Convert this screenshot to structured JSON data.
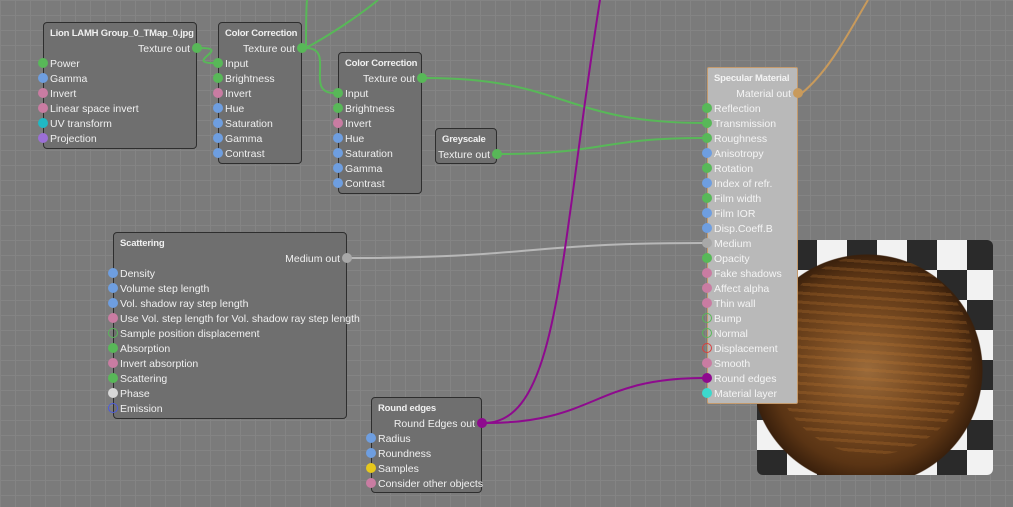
{
  "colors": {
    "green": "#58b858",
    "blue": "#6e9ee0",
    "pink": "#c97ca2",
    "teal": "#1fb9c4",
    "violet": "#9b6fd6",
    "yellow": "#e6c81c",
    "white": "#d8d8d8",
    "grey": "#a8a8a8",
    "red": "#d84040",
    "indigo": "#4a5ae0",
    "purple": "#8e0a8e",
    "cyan": "#3cd8cc",
    "orange": "#c89a5c"
  },
  "nodes": [
    {
      "id": "image",
      "title": "Lion LAMH Group_0_TMap_0.jpg",
      "output": "Texture out",
      "out_color": "green",
      "inputs": [
        {
          "label": "Power",
          "color": "green"
        },
        {
          "label": "Gamma",
          "color": "blue"
        },
        {
          "label": "Invert",
          "color": "pink"
        },
        {
          "label": "Linear space invert",
          "color": "pink"
        },
        {
          "label": "UV transform",
          "color": "teal"
        },
        {
          "label": "Projection",
          "color": "violet"
        }
      ]
    },
    {
      "id": "cc1",
      "title": "Color Correction",
      "output": "Texture out",
      "out_color": "green",
      "inputs": [
        {
          "label": "Input",
          "color": "green"
        },
        {
          "label": "Brightness",
          "color": "green"
        },
        {
          "label": "Invert",
          "color": "pink"
        },
        {
          "label": "Hue",
          "color": "blue"
        },
        {
          "label": "Saturation",
          "color": "blue"
        },
        {
          "label": "Gamma",
          "color": "blue"
        },
        {
          "label": "Contrast",
          "color": "blue"
        }
      ]
    },
    {
      "id": "cc2",
      "title": "Color Correction",
      "output": "Texture out",
      "out_color": "green",
      "inputs": [
        {
          "label": "Input",
          "color": "green"
        },
        {
          "label": "Brightness",
          "color": "green"
        },
        {
          "label": "Invert",
          "color": "pink"
        },
        {
          "label": "Hue",
          "color": "blue"
        },
        {
          "label": "Saturation",
          "color": "blue"
        },
        {
          "label": "Gamma",
          "color": "blue"
        },
        {
          "label": "Contrast",
          "color": "blue"
        }
      ]
    },
    {
      "id": "grey",
      "title": "Greyscale",
      "output": "Texture out",
      "out_color": "green",
      "inputs": []
    },
    {
      "id": "scatter",
      "title": "Scattering",
      "output": "Medium out",
      "out_color": "grey",
      "inputs": [
        {
          "label": "Density",
          "color": "blue"
        },
        {
          "label": "Volume step length",
          "color": "blue"
        },
        {
          "label": "Vol. shadow ray step length",
          "color": "blue"
        },
        {
          "label": "Use Vol. step length for Vol. shadow ray step length",
          "color": "pink"
        },
        {
          "label": "Sample position displacement",
          "color": "green",
          "hollow": true
        },
        {
          "label": "Absorption",
          "color": "green"
        },
        {
          "label": "Invert absorption",
          "color": "pink"
        },
        {
          "label": "Scattering",
          "color": "green"
        },
        {
          "label": "Phase",
          "color": "white"
        },
        {
          "label": "Emission",
          "color": "indigo",
          "hollow": true
        }
      ]
    },
    {
      "id": "round",
      "title": "Round edges",
      "output": "Round Edges out",
      "out_color": "purple",
      "inputs": [
        {
          "label": "Radius",
          "color": "blue"
        },
        {
          "label": "Roundness",
          "color": "blue"
        },
        {
          "label": "Samples",
          "color": "yellow"
        },
        {
          "label": "Consider other objects",
          "color": "pink"
        }
      ]
    },
    {
      "id": "spec",
      "title": "Specular Material",
      "output": "Material out",
      "out_color": "orange",
      "inputs": [
        {
          "label": "Reflection",
          "color": "green"
        },
        {
          "label": "Transmission",
          "color": "green"
        },
        {
          "label": "Roughness",
          "color": "green"
        },
        {
          "label": "Anisotropy",
          "color": "blue"
        },
        {
          "label": "Rotation",
          "color": "green"
        },
        {
          "label": "Index of refr.",
          "color": "blue"
        },
        {
          "label": "Film width",
          "color": "green"
        },
        {
          "label": "Film IOR",
          "color": "blue"
        },
        {
          "label": "Disp.Coeff.B",
          "color": "blue"
        },
        {
          "label": "Medium",
          "color": "grey"
        },
        {
          "label": "Opacity",
          "color": "green"
        },
        {
          "label": "Fake shadows",
          "color": "pink"
        },
        {
          "label": "Affect alpha",
          "color": "pink"
        },
        {
          "label": "Thin wall",
          "color": "pink"
        },
        {
          "label": "Bump",
          "color": "green",
          "hollow": true
        },
        {
          "label": "Normal",
          "color": "green",
          "hollow": true
        },
        {
          "label": "Displacement",
          "color": "red",
          "hollow": true
        },
        {
          "label": "Smooth",
          "color": "pink"
        },
        {
          "label": "Round edges",
          "color": "purple"
        },
        {
          "label": "Material layer",
          "color": "cyan"
        }
      ]
    }
  ]
}
